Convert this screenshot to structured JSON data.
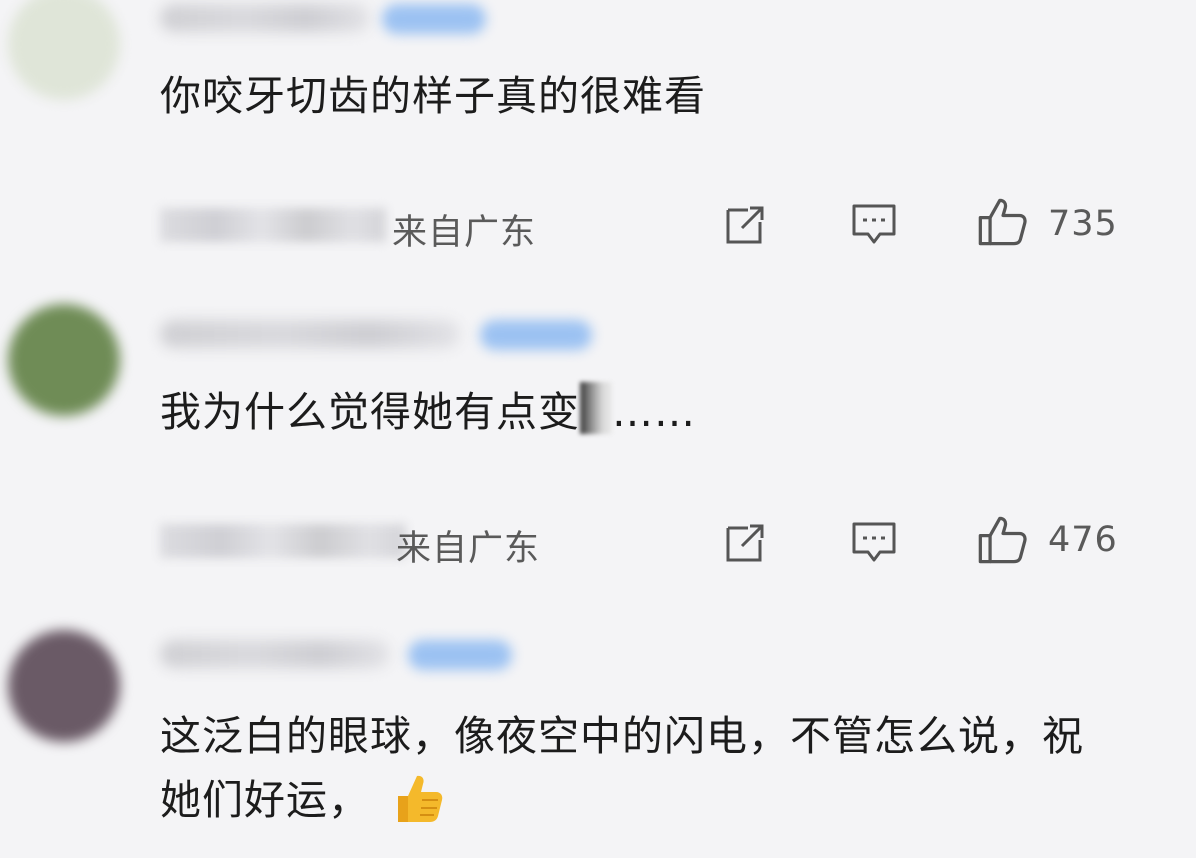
{
  "comments": [
    {
      "text": "你咬牙切齿的样子真的很难看",
      "location": "来自广东",
      "likes": "735",
      "avatar_color": "#d9e0d2"
    },
    {
      "text_before": "我为什么觉得她有点变",
      "text_after": "……",
      "location": "来自广东",
      "likes": "476",
      "avatar_color": "#6d8a54"
    },
    {
      "text": "这泛白的眼球，像夜空中的闪电，不管怎么说，祝她们好运，",
      "avatar_color": "#6b5a66"
    }
  ],
  "icons": {
    "share": "share-icon",
    "comment": "comment-icon",
    "like": "thumbs-up-icon",
    "emoji": "thumbs-up-emoji"
  },
  "colors": {
    "badge": "#9cc2f2",
    "text": "#1c1c1c",
    "meta": "#5a5a5a"
  }
}
